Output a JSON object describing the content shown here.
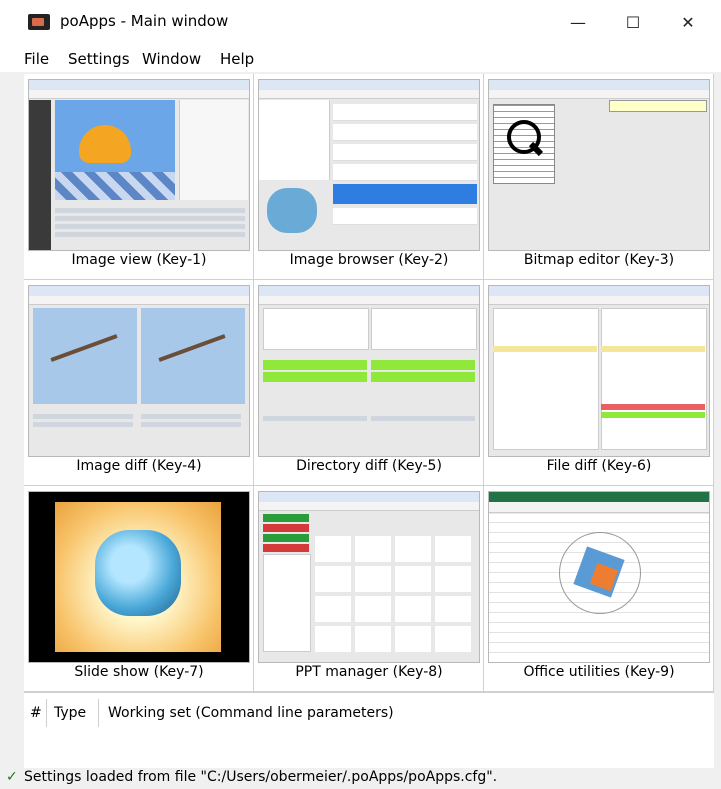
{
  "window": {
    "title": "poApps - Main window",
    "minimize": "—",
    "maximize": "☐",
    "close": "✕"
  },
  "menu": [
    "File",
    "Settings",
    "Window",
    "Help"
  ],
  "tiles": [
    "Image view (Key-1)",
    "Image browser (Key-2)",
    "Bitmap editor (Key-3)",
    "Image diff (Key-4)",
    "Directory diff (Key-5)",
    "File diff (Key-6)",
    "Slide show (Key-7)",
    "PPT manager (Key-8)",
    "Office utilities (Key-9)"
  ],
  "table": {
    "col_num": "#",
    "col_type": "Type",
    "col_working": "Working set (Command line parameters)"
  },
  "status": {
    "check": "✓",
    "message": "Settings loaded from file \"C:/Users/obermeier/.poApps/poApps.cfg\"."
  }
}
